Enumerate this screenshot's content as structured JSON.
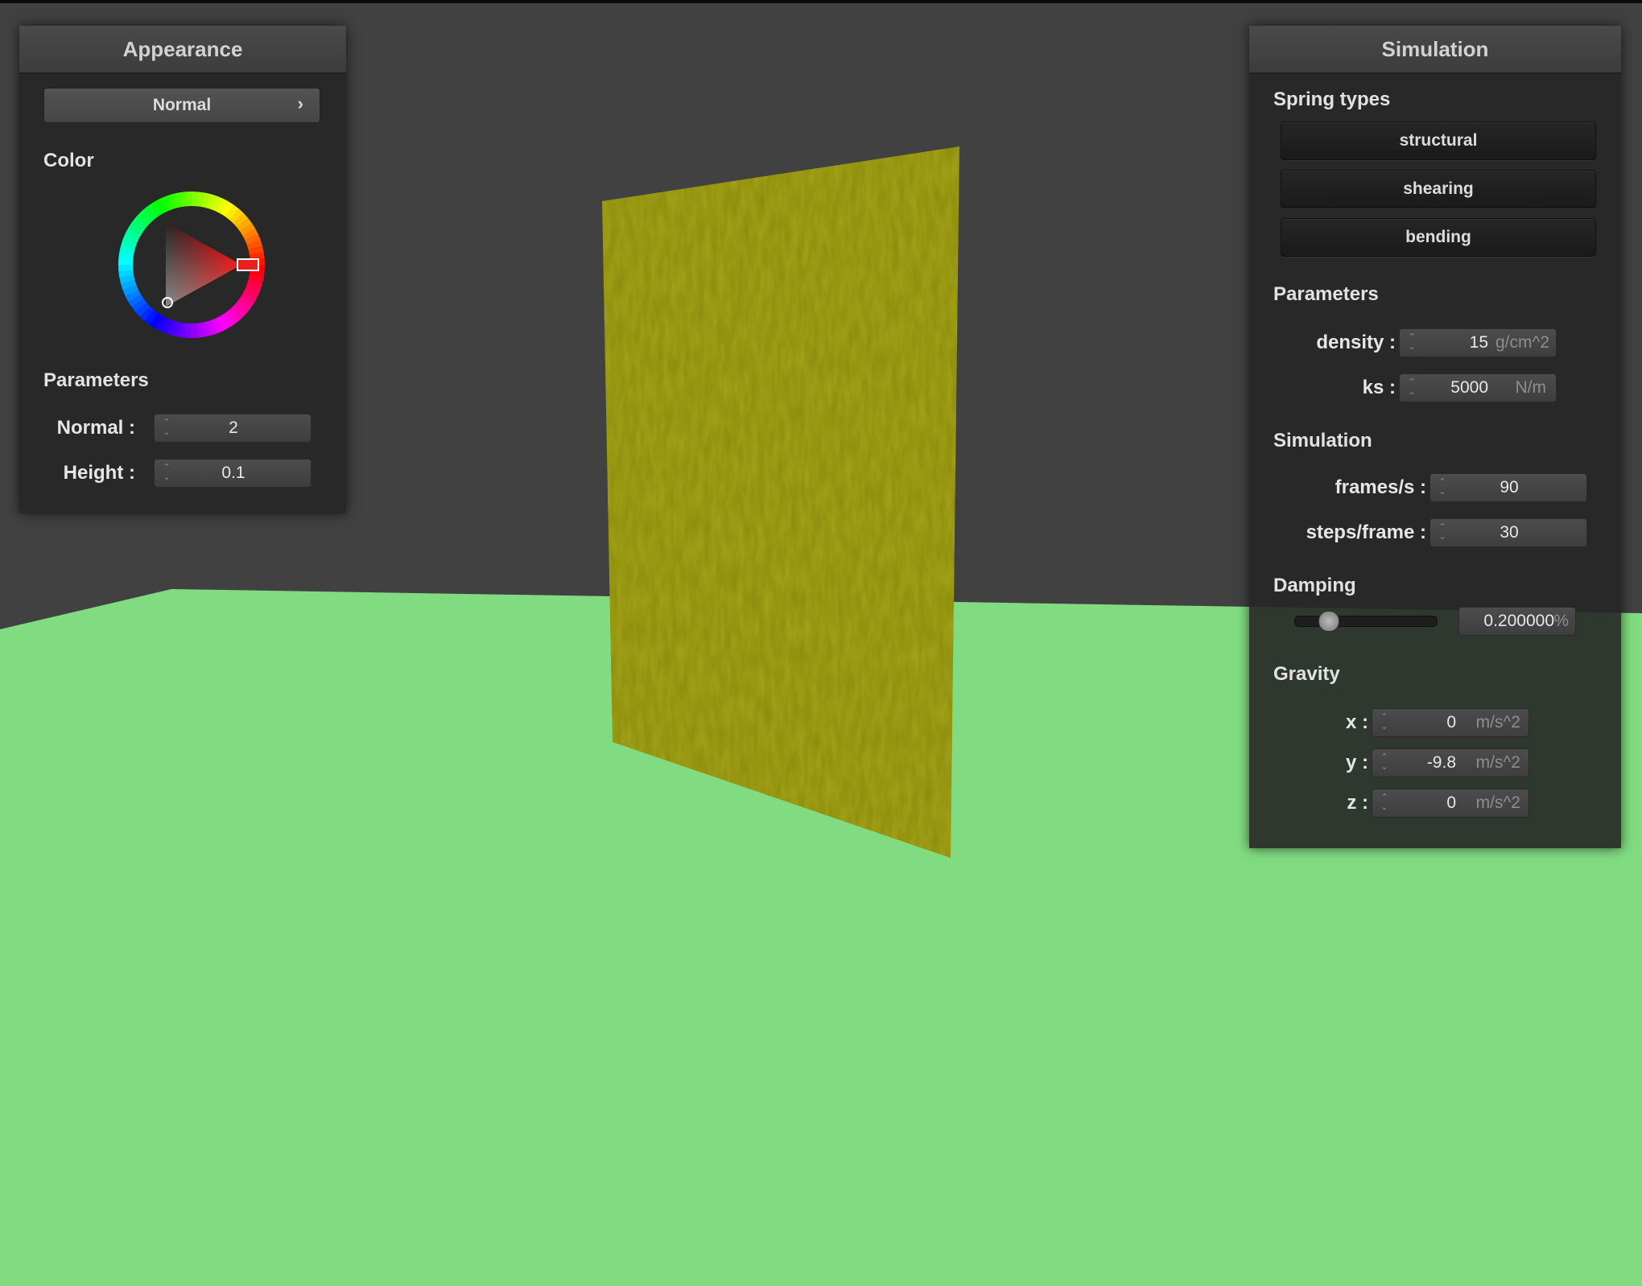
{
  "appearance": {
    "title": "Appearance",
    "mode_button": "Normal",
    "mode_chevron": "›",
    "color_label": "Color",
    "selected_color": "#ff0000",
    "params_label": "Parameters",
    "normal": {
      "label": "Normal :",
      "value": "2"
    },
    "height": {
      "label": "Height :",
      "value": "0.1"
    }
  },
  "simulation": {
    "title": "Simulation",
    "spring_types_label": "Spring types",
    "spring_types": [
      "structural",
      "shearing",
      "bending"
    ],
    "params_label": "Parameters",
    "density": {
      "label": "density :",
      "value": "15",
      "unit": "g/cm^2"
    },
    "ks": {
      "label": "ks :",
      "value": "5000",
      "unit": "N/m"
    },
    "sim_label": "Simulation",
    "fps": {
      "label": "frames/s :",
      "value": "90"
    },
    "steps": {
      "label": "steps/frame :",
      "value": "30"
    },
    "damping_label": "Damping",
    "damping": {
      "value": "0.200000",
      "unit": "%",
      "slider_level": 0.2
    },
    "gravity_label": "Gravity",
    "gx": {
      "label": "x :",
      "value": "0",
      "unit": "m/s^2"
    },
    "gy": {
      "label": "y :",
      "value": "-9.8",
      "unit": "m/s^2"
    },
    "gz": {
      "label": "z :",
      "value": "0",
      "unit": "m/s^2"
    }
  },
  "scene": {
    "background_color": "#414141",
    "floor_color": "#81dc81",
    "cloth_color": "#8c8c0a"
  }
}
